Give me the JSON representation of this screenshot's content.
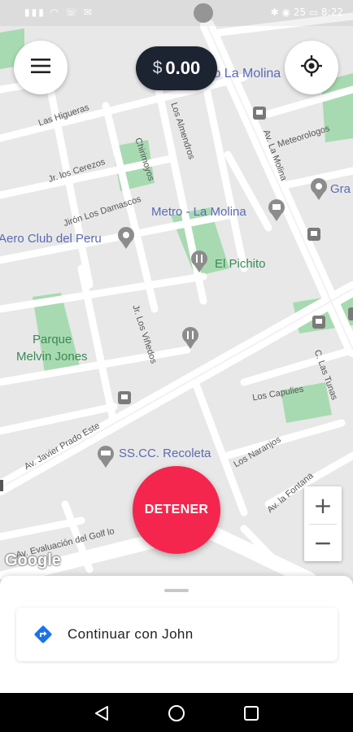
{
  "status_bar": {
    "left_icons": "▮▮▮ ◠ ☏ ✉",
    "right_text": "✱ ◉ 25 ▭ 8:22"
  },
  "map": {
    "labels": {
      "la_molina_top": "to La Molina",
      "las_higueras": "Las Higueras",
      "los_almendros": "Los Almendros",
      "meteorologos": "Meteorologos",
      "av_la_molina": "Av. La Molina",
      "chirimoyos": "Chirimoyos",
      "los_cerezos": "Jr. los Cerezos",
      "los_damascos": "Jirón Los Damascos",
      "metro": "Metro - La Molina",
      "gra": "Gra",
      "aero_club": "Aero Club del Peru",
      "el_pichito": "El Pichito",
      "parque_1": "Parque",
      "parque_2": "Melvin Jones",
      "los_vinedos": "Jr. Los Viñedos",
      "c_los_tunas": "C. Las Tunas",
      "los_capulies": "Los Capulies",
      "javier_prado": "Av. Javier Prado Este",
      "recoleta": "SS.CC. Recoleta",
      "los_naranjos": "Los Naranjos",
      "la_fontana": "Av. la Fontana",
      "golf": "Av. Evaluación del Golf lo"
    },
    "google_logo": "Google"
  },
  "header": {
    "menu_icon": "hamburger-icon",
    "locate_icon": "crosshair-icon",
    "currency": "$",
    "amount": "0.00"
  },
  "zoom": {
    "in": "+",
    "out": "−"
  },
  "stop_button": {
    "label": "DETENER"
  },
  "sheet": {
    "card_label": "Continuar con John",
    "card_icon": "directions-icon"
  },
  "colors": {
    "accent": "#f5264d",
    "pill_bg": "#1c2331",
    "park": "#b9e2bf",
    "road": "#ffffff",
    "directions": "#1a73e8"
  }
}
